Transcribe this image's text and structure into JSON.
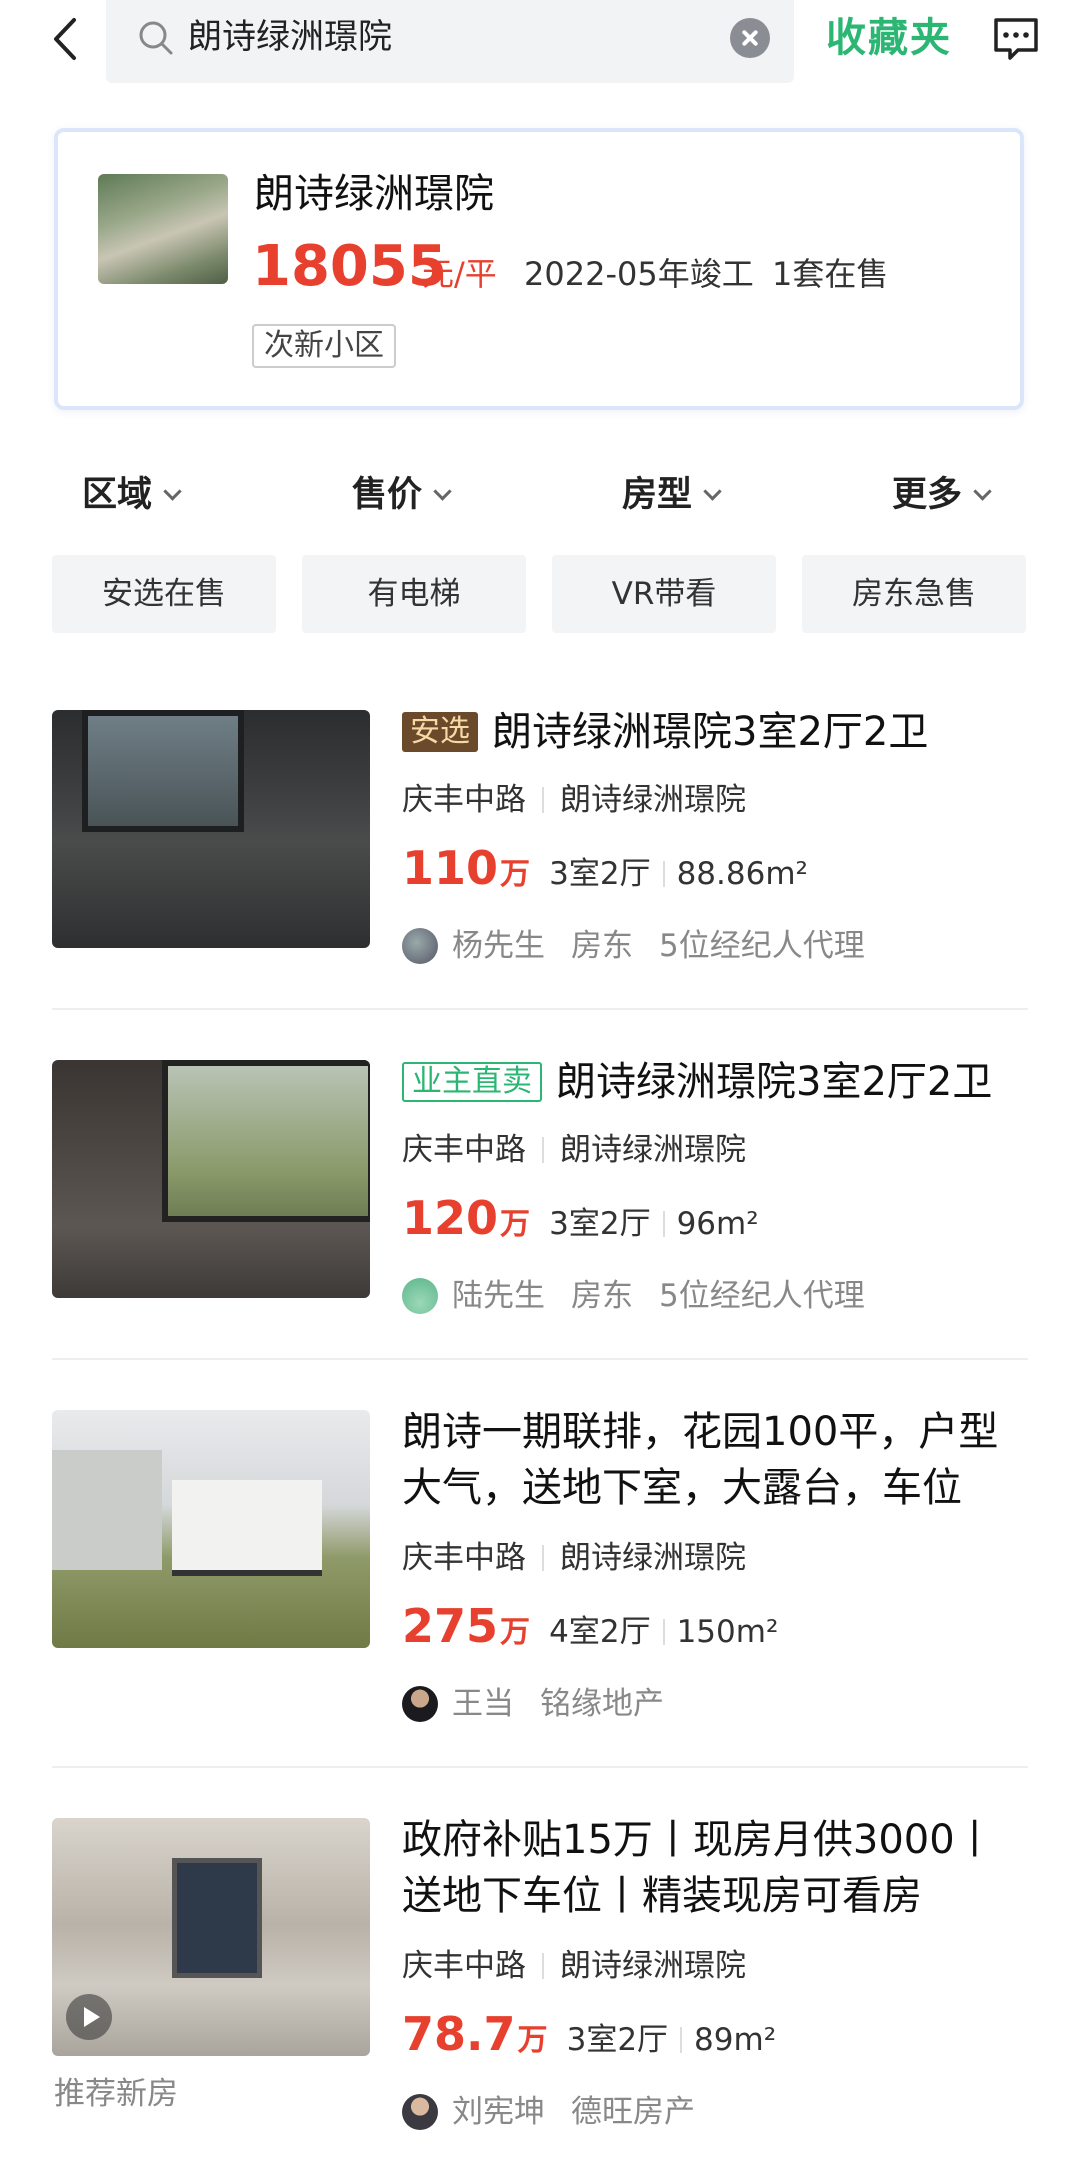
{
  "search": {
    "query": "朗诗绿洲璟院"
  },
  "header": {
    "favorites_label": "收藏夹"
  },
  "community": {
    "name": "朗诗绿洲璟院",
    "price": "18055",
    "price_unit": "元/平",
    "completed": "2022-05年竣工",
    "on_sale": "1套在售",
    "tag": "次新小区"
  },
  "filters": [
    "区域",
    "售价",
    "房型",
    "更多"
  ],
  "chips": [
    "安选在售",
    "有电梯",
    "VR带看",
    "房东急售"
  ],
  "listings": [
    {
      "badge": "安选",
      "title": "朗诗绿洲璟院3室2厅2卫",
      "road": "庆丰中路",
      "community": "朗诗绿洲璟院",
      "price": "110",
      "price_unit": "万",
      "layout": "3室2厅",
      "area": "88.86m²",
      "agent_name": "杨先生",
      "agent_role": "房东",
      "agent_note": "5位经纪人代理"
    },
    {
      "badge": "业主直卖",
      "title": "朗诗绿洲璟院3室2厅2卫",
      "road": "庆丰中路",
      "community": "朗诗绿洲璟院",
      "price": "120",
      "price_unit": "万",
      "layout": "3室2厅",
      "area": "96m²",
      "agent_name": "陆先生",
      "agent_role": "房东",
      "agent_note": "5位经纪人代理"
    },
    {
      "title_line1": "朗诗一期联排，花园100平，户型",
      "title_line2": "大气，送地下室，大露台，车位",
      "road": "庆丰中路",
      "community": "朗诗绿洲璟院",
      "price": "275",
      "price_unit": "万",
      "layout": "4室2厅",
      "area": "150m²",
      "agent_name": "王当",
      "agent_company": "铭缘地产"
    },
    {
      "title_line1": "政府补贴15万丨现房月供3000丨",
      "title_line2": "送地下车位丨精装现房可看房",
      "road": "庆丰中路",
      "community": "朗诗绿洲璟院",
      "price": "78.7",
      "price_unit": "万",
      "layout": "3室2厅",
      "area": "89m²",
      "agent_name": "刘宪坤",
      "agent_company": "德旺房产"
    }
  ],
  "recommend_label": "推荐新房",
  "colors": {
    "accent_green": "#2bb673",
    "price_red": "#e8402e"
  }
}
